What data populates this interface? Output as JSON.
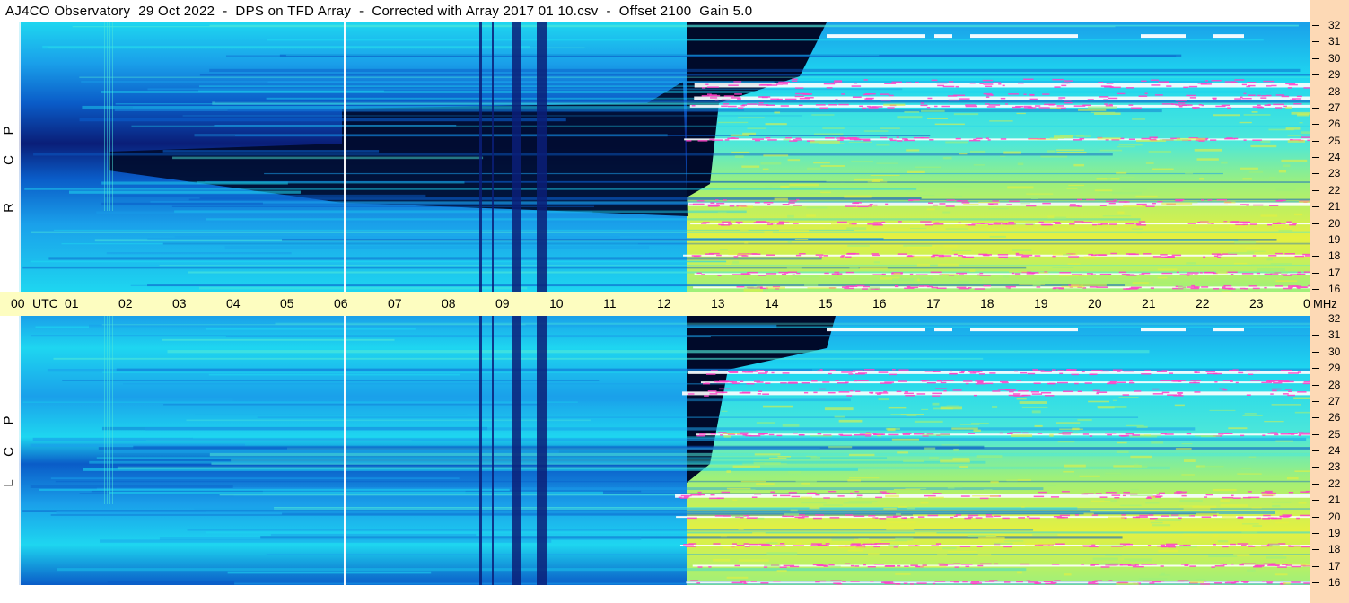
{
  "title": "AJ4CO Observatory  29 Oct 2022  -  DPS on TFD Array  -  Corrected with Array 2017 01 10.csv  -  Offset 2100  Gain 5.0",
  "panels": {
    "rcp": {
      "label": [
        "R",
        "C",
        "P"
      ]
    },
    "lcp": {
      "label": [
        "L",
        "C",
        "P"
      ]
    }
  },
  "chart_data": {
    "type": "heatmap",
    "x_unit": "UTC",
    "y_unit": "MHz",
    "x_ticks": [
      "00",
      "01",
      "02",
      "03",
      "04",
      "05",
      "06",
      "07",
      "08",
      "09",
      "10",
      "11",
      "12",
      "13",
      "14",
      "15",
      "16",
      "17",
      "18",
      "19",
      "20",
      "21",
      "22",
      "23",
      "00"
    ],
    "y_ticks": [
      "32",
      "31",
      "30",
      "29",
      "28",
      "27",
      "26",
      "25",
      "24",
      "23",
      "22",
      "21",
      "20",
      "19",
      "18",
      "17",
      "16"
    ],
    "xlim": [
      0,
      24
    ],
    "ylim": [
      16,
      32
    ],
    "colors": {
      "dark": "#000a2a",
      "deep_blue": "#0a1e78",
      "blue": "#0a5cc8",
      "sky": "#1aa0ea",
      "cyan": "#1ed6f0",
      "aqua": "#4fe8d8",
      "green": "#9ef07a",
      "yellow": "#e6f040",
      "magenta": "#ff3fc8",
      "white": "#ffffff"
    }
  }
}
